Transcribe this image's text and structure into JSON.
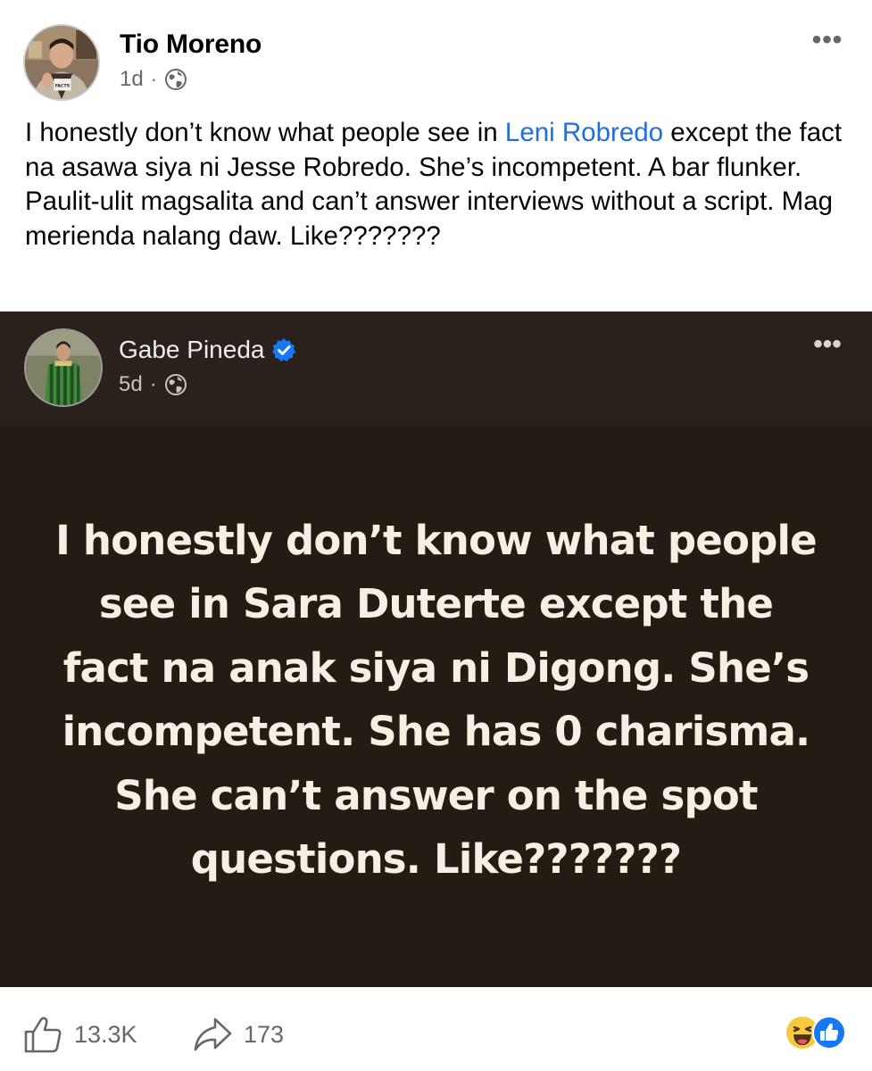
{
  "post": {
    "author": "Tio Moreno",
    "time": "1d",
    "separator": "·",
    "more_label": "•••",
    "text_before": "I honestly don’t know what people see in ",
    "mention": "Leni Robredo",
    "text_after": " except the fact na asawa siya ni Jesse Robredo. She’s incompetent. A bar flunker. Paulit-ulit magsalita and can’t answer interviews without a script. Mag merienda nalang daw. Like???????"
  },
  "shared_post": {
    "author": "Gabe Pineda",
    "verified": true,
    "time": "5d",
    "separator": "·",
    "more_label": "•••",
    "quote": "I honestly don’t know what people see in Sara Duterte except the fact na anak siya ni Digong. She’s incompetent. She has 0 charisma. She can’t answer on the spot questions. Like???????"
  },
  "footer": {
    "likes": "13.3K",
    "shares": "173"
  },
  "icons": {
    "privacy": "globe-icon",
    "verified": "verified-badge-icon",
    "like": "thumbs-up-icon",
    "share": "share-arrow-icon",
    "reactions": [
      "haha-reaction-icon",
      "like-reaction-icon"
    ]
  },
  "colors": {
    "mention": "#216fdb",
    "shared_background": "#251b15",
    "shared_header": "#2b211c",
    "quote_text": "#f5efe4",
    "verified": "#1877f2"
  }
}
